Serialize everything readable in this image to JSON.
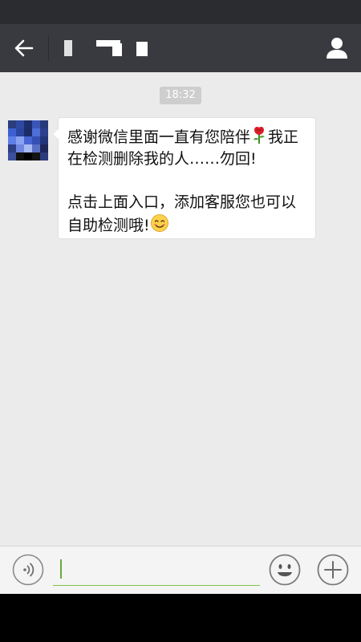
{
  "header": {
    "back_icon": "arrow-left-icon",
    "chat_title": "",
    "profile_icon": "person-icon",
    "background_color": "#393a3f"
  },
  "chat": {
    "background_color": "#ebebeb",
    "timestamp": "18:32",
    "messages": [
      {
        "sender": "other",
        "avatar": "pixelated-avatar",
        "parts": [
          "感谢微信里面一直有您陪伴",
          "我正在检测删除我的人……勿回!\n\n点击上面入口，添加客服您也可以自助检测哦!",
          ""
        ],
        "emoji": [
          "rose-emoji",
          "smiling-face-emoji"
        ]
      }
    ]
  },
  "input_bar": {
    "voice_icon": "voice-icon",
    "text_value": "",
    "emoji_icon": "emoji-icon",
    "plus_icon": "plus-icon",
    "accent_color": "#7fc44f"
  }
}
